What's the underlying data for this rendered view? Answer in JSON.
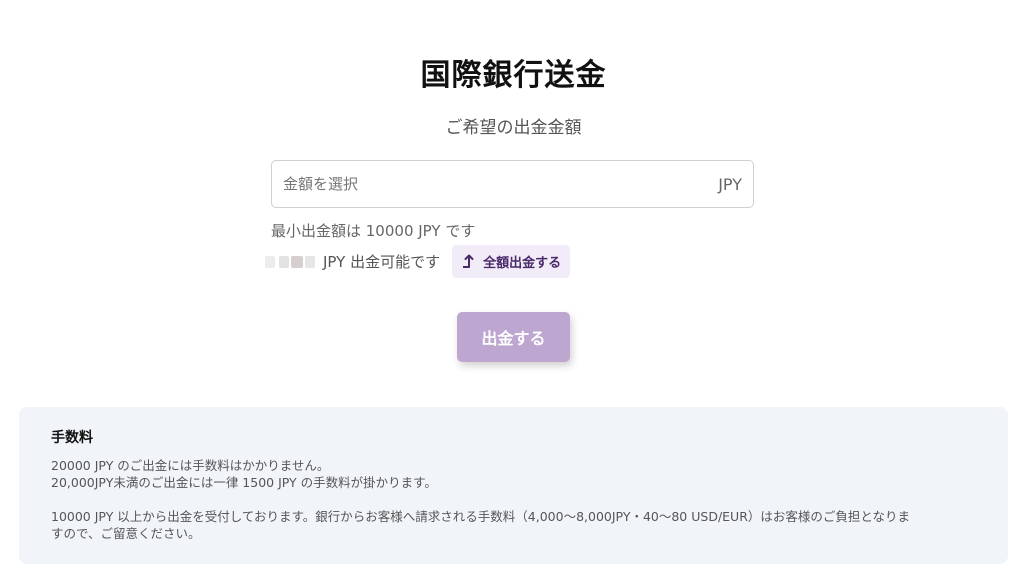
{
  "page": {
    "title": "国際銀行送金",
    "subtitle": "ご希望の出金金額"
  },
  "amount": {
    "placeholder": "金額を選択",
    "currency": "JPY"
  },
  "min_note": "最小出金額は 10000 JPY です",
  "available": {
    "text": "JPY 出金可能です",
    "withdraw_all_label": "全額出金する"
  },
  "submit_label": "出金する",
  "fees": {
    "title": "手数料",
    "line1": "20000 JPY のご出金には手数料はかかりません。",
    "line2": "20,000JPY未満のご出金には一律 1500 JPY の手数料が掛かります。",
    "line3": "10000 JPY 以上から出金を受付しております。銀行からお客様へ請求される手数料（4,000〜8,000JPY・40〜80 USD/EUR）はお客様のご負担となりま",
    "line4": "すので、ご留意ください。"
  },
  "colors": {
    "accent": "#bda7d0",
    "accent_text": "#4a2a6a",
    "accent_bg": "#f1ecf7",
    "fee_bg": "#f1f5fa"
  },
  "icons": {
    "withdraw_all": "arrow-up-icon"
  }
}
